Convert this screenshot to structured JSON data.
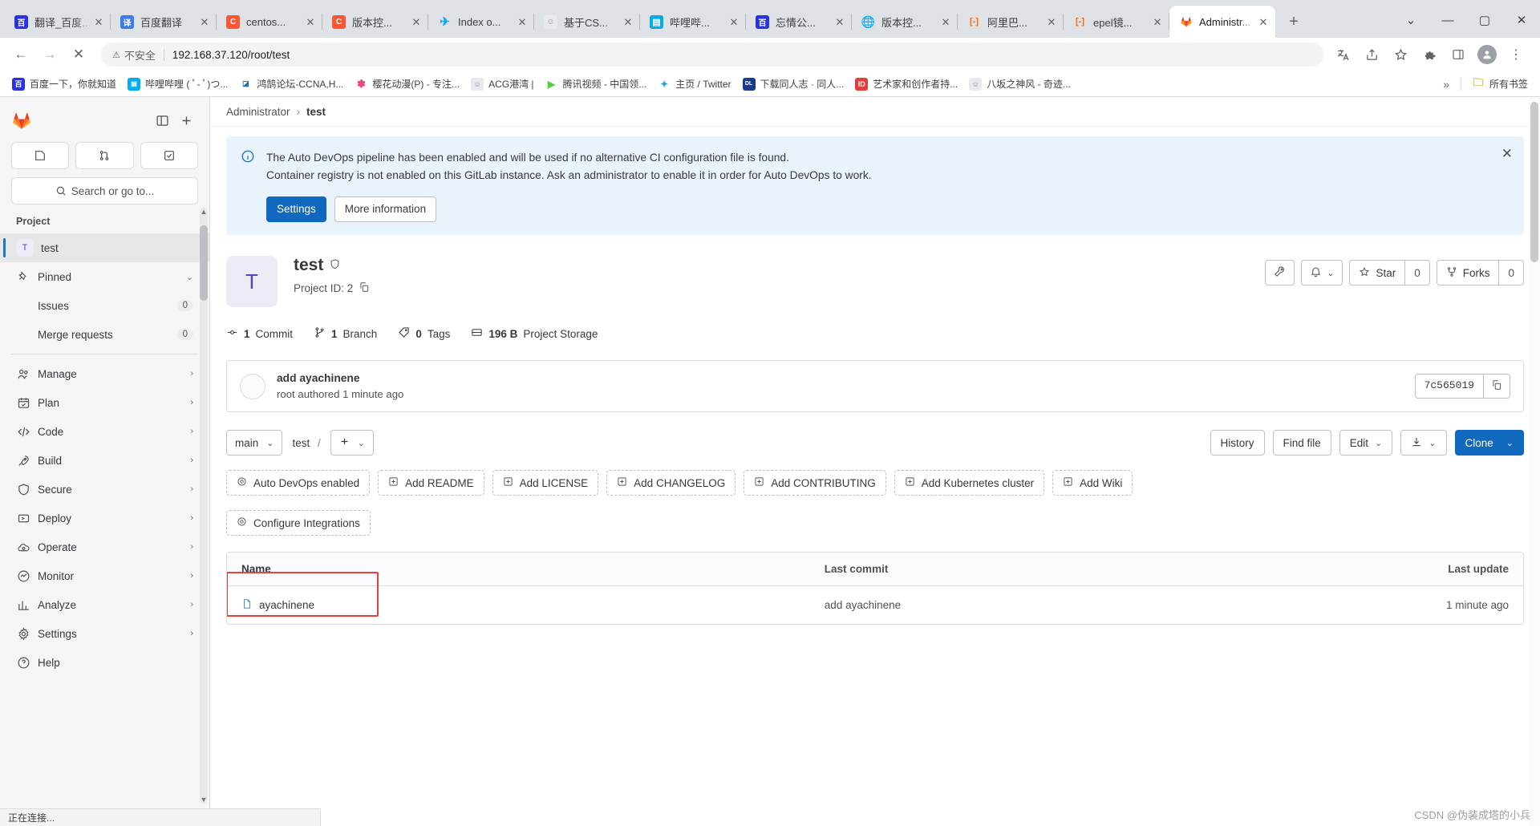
{
  "browser": {
    "tabs": [
      {
        "label": "翻译_百度...",
        "icon": "baidu-icon",
        "color": "#2932e1",
        "glyph": "百"
      },
      {
        "label": "百度翻译",
        "icon": "baidu-translate-icon",
        "color": "#3a7cf0",
        "glyph": "译"
      },
      {
        "label": "centos...",
        "icon": "csdn-icon",
        "color": "#fc5531",
        "glyph": "C"
      },
      {
        "label": "版本控...",
        "icon": "csdn-icon",
        "color": "#fc5531",
        "glyph": "C"
      },
      {
        "label": "Index o...",
        "icon": "nginx-icon",
        "color": "#1ba0e1",
        "glyph": "≈"
      },
      {
        "label": "基于CS...",
        "icon": "generic-icon",
        "color": "#e8e8ee",
        "glyph": "☺"
      },
      {
        "label": "哔哩哔...",
        "icon": "bilibili-icon",
        "color": "#00aeec",
        "glyph": "📺"
      },
      {
        "label": "忘情公...",
        "icon": "baidu-icon",
        "color": "#2932e1",
        "glyph": "百"
      },
      {
        "label": "版本控...",
        "icon": "globe-icon",
        "color": "#6b7075",
        "glyph": "🌐"
      },
      {
        "label": "阿里巴...",
        "icon": "aliyun-icon",
        "color": "#ff6a00",
        "glyph": "[-]"
      },
      {
        "label": "epel镜...",
        "icon": "aliyun-icon",
        "color": "#ff6a00",
        "glyph": "[-]"
      },
      {
        "label": "Administr...",
        "icon": "gitlab-icon",
        "color": "#fc6d26",
        "glyph": "🦊",
        "active": true
      }
    ],
    "new_tab_label": "+",
    "window_controls": {
      "restore_down": "⌄",
      "minimize": "—",
      "maximize": "▢",
      "close": "✕"
    },
    "nav": {
      "back": "←",
      "forward": "→",
      "stop": "✕"
    },
    "omnibox": {
      "security_label": "不安全",
      "security_icon": "warning-triangle-icon",
      "url": "192.168.37.120/root/test"
    },
    "toolbar_right": {
      "translate_icon": "translate-icon",
      "share_icon": "share-icon",
      "bookmark_icon": "star-icon",
      "extensions_icon": "puzzle-icon",
      "sidepanel_icon": "sidepanel-icon",
      "profile_icon": "avatar-icon",
      "menu_icon": "kebab-menu-icon"
    },
    "bookmarks": [
      {
        "label": "百度一下，你就知道",
        "color": "#2932e1",
        "glyph": "百"
      },
      {
        "label": "哔哩哔哩 ( ﾟ- ﾟ)つ...",
        "color": "#00aeec",
        "glyph": "📺"
      },
      {
        "label": "鸿鹄论坛-CCNA,H...",
        "color": "#1f6fb5",
        "glyph": "H"
      },
      {
        "label": "樱花动漫(P) - 专注...",
        "color": "#f0447f",
        "glyph": "✿"
      },
      {
        "label": "ACG港湾 |",
        "color": "#e8e8ee",
        "glyph": "☺"
      },
      {
        "label": "腾讯视频 - 中国领...",
        "color": "#5cc943",
        "glyph": "▶"
      },
      {
        "label": "主页 / Twitter",
        "color": "#1da1f2",
        "glyph": "🐦"
      },
      {
        "label": "下载同人志 · 同人...",
        "color": "#1b3a8c",
        "glyph": "DL"
      },
      {
        "label": "艺术家和创作者持...",
        "color": "#e23c3c",
        "glyph": "ID"
      },
      {
        "label": "八坂之神风 - 奇迹...",
        "color": "#e8e8ee",
        "glyph": "神"
      }
    ],
    "bookmarks_overflow": "»",
    "all_bookmarks_label": "所有书签",
    "all_bookmarks_icon": "folder-icon",
    "status_text": "正在连接..."
  },
  "gitlab": {
    "sidebar": {
      "logo_icon": "gitlab-tanuki-icon",
      "collapse_icon": "sidebar-toggle-icon",
      "create_icon": "plus-icon",
      "quick_actions": [
        {
          "name": "issues-shortcut",
          "icon": "issue-icon"
        },
        {
          "name": "merge-requests-shortcut",
          "icon": "merge-request-icon"
        },
        {
          "name": "todos-shortcut",
          "icon": "todo-check-icon"
        }
      ],
      "search_placeholder": "Search or go to...",
      "search_icon": "search-icon",
      "section_title": "Project",
      "project": {
        "initial": "T",
        "label": "test"
      },
      "pinned": {
        "label": "Pinned",
        "icon": "pin-icon",
        "chevron": "⌄"
      },
      "pinned_items": [
        {
          "label": "Issues",
          "count": "0"
        },
        {
          "label": "Merge requests",
          "count": "0"
        }
      ],
      "items": [
        {
          "label": "Manage",
          "icon": "users-icon",
          "chevron": "›"
        },
        {
          "label": "Plan",
          "icon": "calendar-icon",
          "chevron": "›"
        },
        {
          "label": "Code",
          "icon": "code-icon",
          "chevron": "›"
        },
        {
          "label": "Build",
          "icon": "rocket-icon",
          "chevron": "›"
        },
        {
          "label": "Secure",
          "icon": "shield-icon",
          "chevron": "›"
        },
        {
          "label": "Deploy",
          "icon": "deploy-icon",
          "chevron": "›"
        },
        {
          "label": "Operate",
          "icon": "cloud-gear-icon",
          "chevron": "›"
        },
        {
          "label": "Monitor",
          "icon": "monitor-icon",
          "chevron": "›"
        },
        {
          "label": "Analyze",
          "icon": "chart-icon",
          "chevron": "›"
        },
        {
          "label": "Settings",
          "icon": "gear-icon",
          "chevron": "›"
        },
        {
          "label": "Help",
          "icon": "help-icon",
          "chevron": ""
        }
      ]
    },
    "breadcrumb": {
      "root": "Administrator",
      "sep": "›",
      "current": "test"
    },
    "alert": {
      "icon": "info-circle-icon",
      "line1": "The Auto DevOps pipeline has been enabled and will be used if no alternative CI configuration file is found.",
      "line2": "Container registry is not enabled on this GitLab instance. Ask an administrator to enable it in order for Auto DevOps to work.",
      "settings_label": "Settings",
      "more_label": "More information",
      "close_icon": "close-icon"
    },
    "project": {
      "avatar_initial": "T",
      "name": "test",
      "visibility_icon": "shield-private-icon",
      "id_label": "Project ID: 2",
      "copy_icon": "copy-icon",
      "actions": {
        "wrench_icon": "wrench-icon",
        "bell_icon": "bell-icon",
        "bell_chevron": "⌄",
        "star_icon": "star-icon",
        "star_label": "Star",
        "star_count": "0",
        "fork_icon": "fork-icon",
        "fork_label": "Forks",
        "fork_count": "0"
      },
      "stats": [
        {
          "icon": "commit-icon",
          "value": "1",
          "label": "Commit"
        },
        {
          "icon": "branch-icon",
          "value": "1",
          "label": "Branch"
        },
        {
          "icon": "tag-icon",
          "value": "0",
          "label": "Tags"
        },
        {
          "icon": "storage-icon",
          "value": "196 B",
          "label": "Project Storage"
        }
      ]
    },
    "commit": {
      "title": "add ayachinene",
      "subtitle": "root authored 1 minute ago",
      "sha": "7c565019",
      "copy_icon": "copy-icon"
    },
    "repo_bar": {
      "branch": "main",
      "branch_chevron": "⌄",
      "path_root": "test",
      "path_sep": "/",
      "add_icon": "plus-icon",
      "add_chevron": "⌄",
      "history_label": "History",
      "findfile_label": "Find file",
      "edit_label": "Edit",
      "edit_chevron": "⌄",
      "download_icon": "download-icon",
      "download_chevron": "⌄",
      "clone_label": "Clone",
      "clone_chevron": "⌄"
    },
    "quick_adds": [
      {
        "label": "Auto DevOps enabled",
        "icon": "gear-icon"
      },
      {
        "label": "Add README",
        "icon": "plus-square-icon"
      },
      {
        "label": "Add LICENSE",
        "icon": "plus-square-icon"
      },
      {
        "label": "Add CHANGELOG",
        "icon": "plus-square-icon"
      },
      {
        "label": "Add CONTRIBUTING",
        "icon": "plus-square-icon"
      },
      {
        "label": "Add Kubernetes cluster",
        "icon": "plus-square-icon"
      },
      {
        "label": "Add Wiki",
        "icon": "plus-square-icon"
      },
      {
        "label": "Configure Integrations",
        "icon": "gear-icon"
      }
    ],
    "file_table": {
      "headers": {
        "name": "Name",
        "last_commit": "Last commit",
        "last_update": "Last update"
      },
      "rows": [
        {
          "name": "ayachinene",
          "icon": "file-icon",
          "last_commit": "add ayachinene",
          "last_update": "1 minute ago",
          "highlighted": true
        }
      ]
    },
    "highlight_color": "#e8413a"
  },
  "watermark": "CSDN @伪装成塔的小兵"
}
